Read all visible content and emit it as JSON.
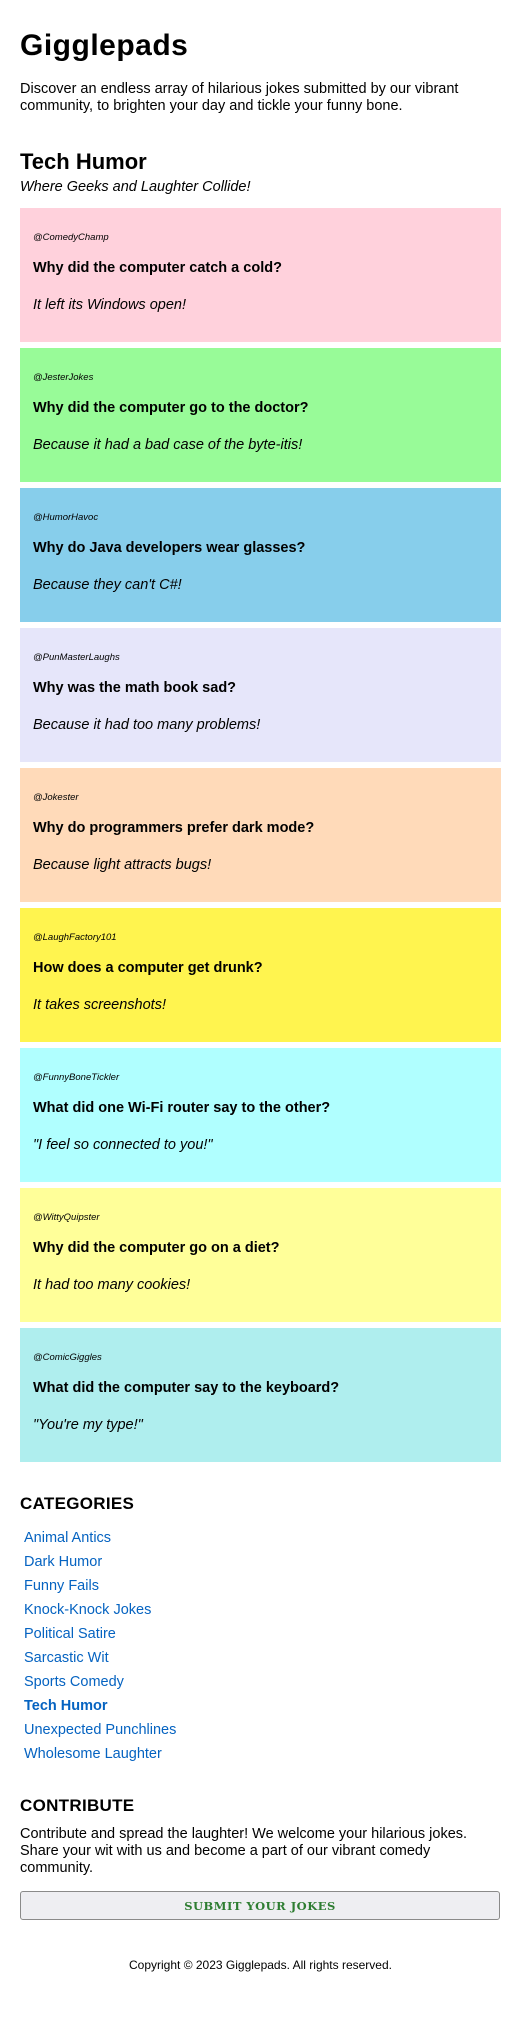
{
  "header": {
    "site_title": "Gigglepads",
    "intro": "Discover an endless array of hilarious jokes submitted by our vibrant community, to brighten your day and tickle your funny bone."
  },
  "section": {
    "title": "Tech Humor",
    "tagline": "Where Geeks and Laughter Collide!"
  },
  "jokes": [
    {
      "author": "@ComedyChamp",
      "question": "Why did the computer catch a cold?",
      "answer": "It left its Windows open!",
      "color": "#ffd1dc"
    },
    {
      "author": "@JesterJokes",
      "question": "Why did the computer go to the doctor?",
      "answer": "Because it had a bad case of the byte-itis!",
      "color": "#98fb98"
    },
    {
      "author": "@HumorHavoc",
      "question": "Why do Java developers wear glasses?",
      "answer": "Because they can't C#!",
      "color": "#87ceeb"
    },
    {
      "author": "@PunMasterLaughs",
      "question": "Why was the math book sad?",
      "answer": "Because it had too many problems!",
      "color": "#e6e6fa"
    },
    {
      "author": "@Jokester",
      "question": "Why do programmers prefer dark mode?",
      "answer": "Because light attracts bugs!",
      "color": "#ffdab9"
    },
    {
      "author": "@LaughFactory101",
      "question": "How does a computer get drunk?",
      "answer": "It takes screenshots!",
      "color": "#fff44f"
    },
    {
      "author": "@FunnyBoneTickler",
      "question": "What did one Wi-Fi router say to the other?",
      "answer": "\"I feel so connected to you!\"",
      "color": "#b0ffff"
    },
    {
      "author": "@WittyQuipster",
      "question": "Why did the computer go on a diet?",
      "answer": "It had too many cookies!",
      "color": "#ffff99"
    },
    {
      "author": "@ComicGiggles",
      "question": "What did the computer say to the keyboard?",
      "answer": "\"You're my type!\"",
      "color": "#afeeee"
    }
  ],
  "categories": {
    "heading": "CATEGORIES",
    "items": [
      {
        "label": "Animal Antics",
        "active": false
      },
      {
        "label": "Dark Humor",
        "active": false
      },
      {
        "label": "Funny Fails",
        "active": false
      },
      {
        "label": "Knock-Knock Jokes",
        "active": false
      },
      {
        "label": "Political Satire",
        "active": false
      },
      {
        "label": "Sarcastic Wit",
        "active": false
      },
      {
        "label": "Sports Comedy",
        "active": false
      },
      {
        "label": "Tech Humor",
        "active": true
      },
      {
        "label": "Unexpected Punchlines",
        "active": false
      },
      {
        "label": "Wholesome Laughter",
        "active": false
      }
    ]
  },
  "contribute": {
    "heading": "CONTRIBUTE",
    "text": "Contribute and spread the laughter! We welcome your hilarious jokes. Share your wit with us and become a part of our vibrant comedy community.",
    "button_label": "SUBMIT YOUR JOKES"
  },
  "footer": {
    "copyright": "Copyright © 2023 Gigglepads. All rights reserved."
  }
}
